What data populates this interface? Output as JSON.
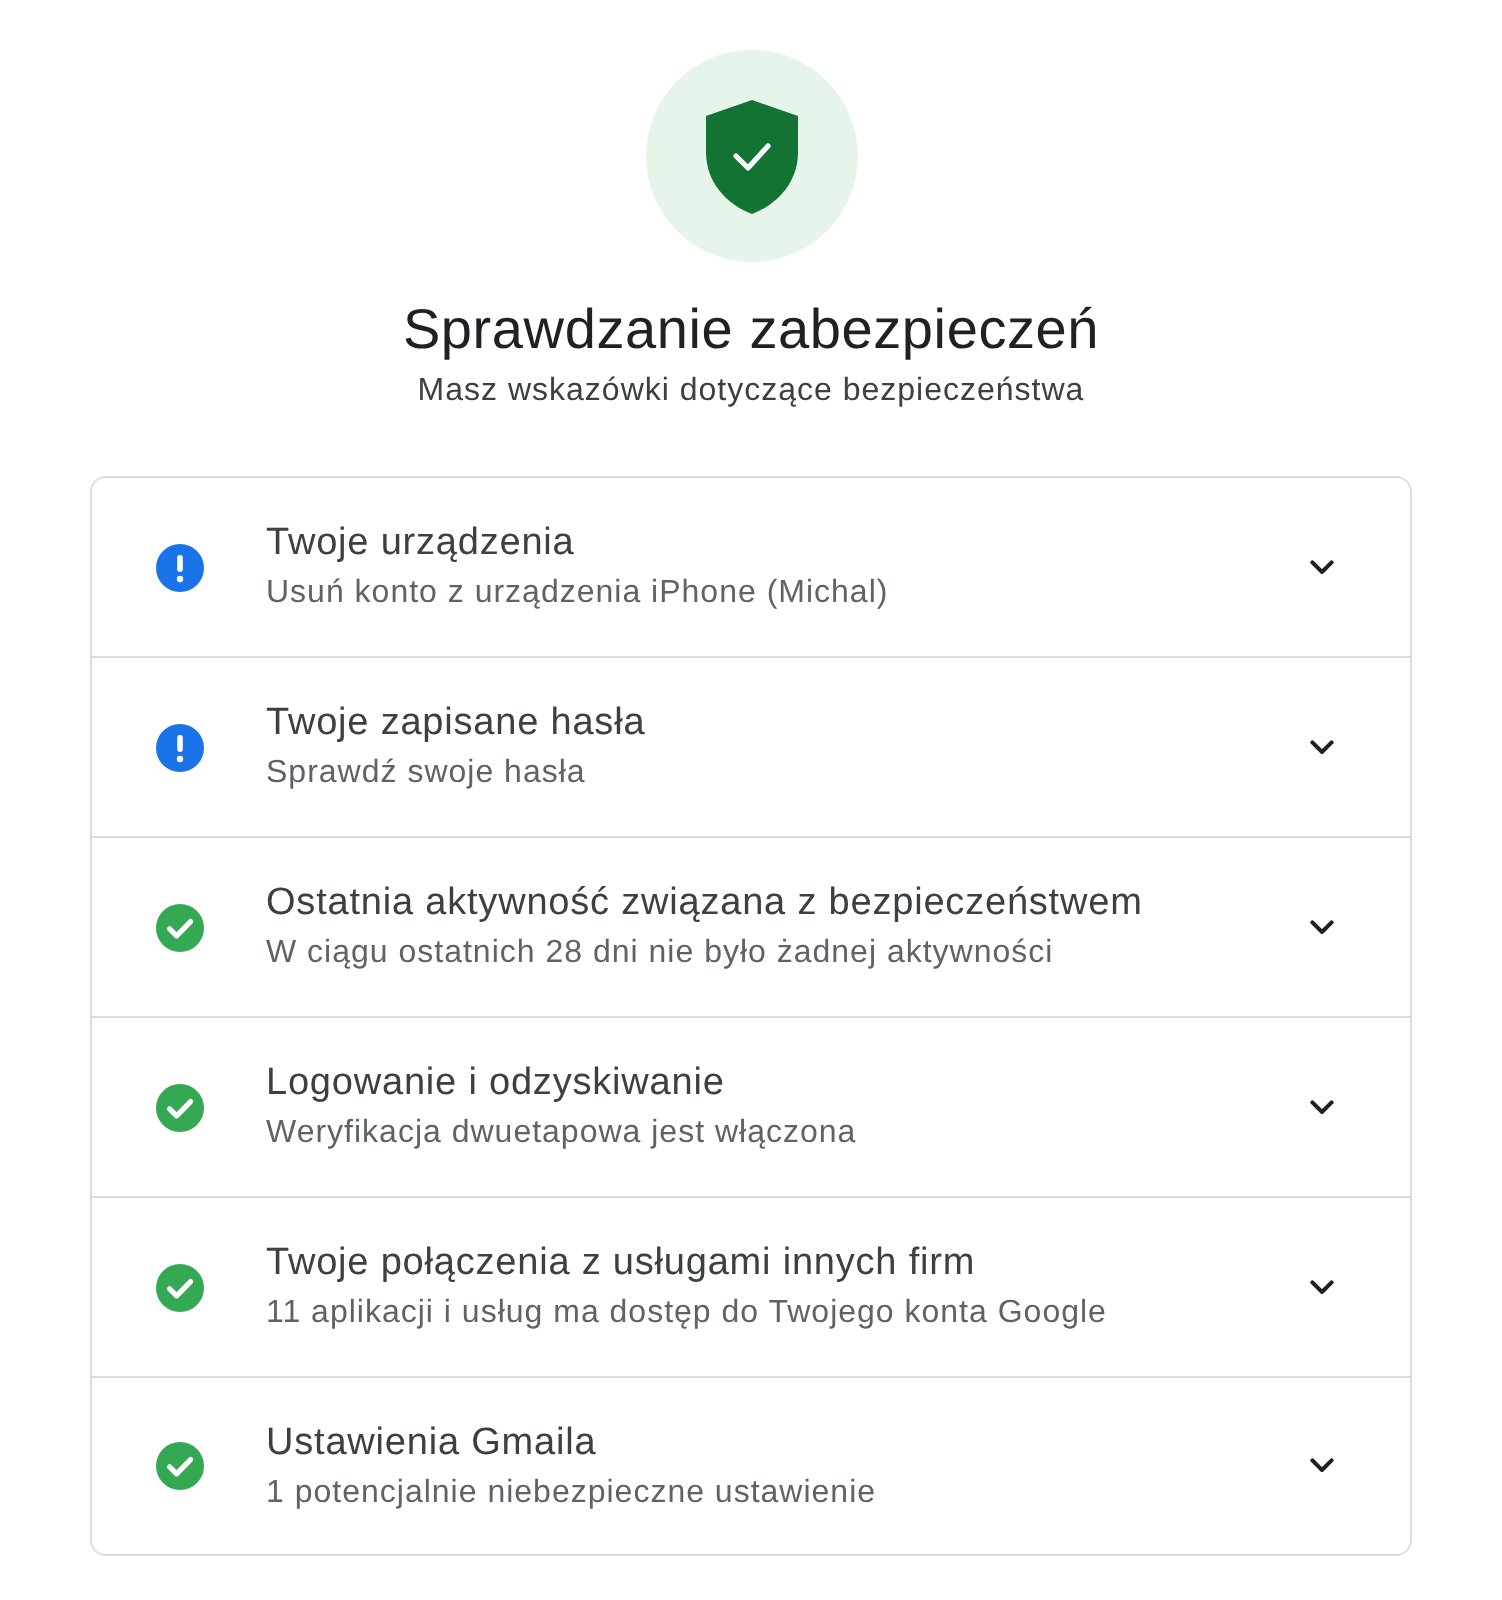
{
  "header": {
    "title": "Sprawdzanie zabezpieczeń",
    "subtitle": "Masz wskazówki dotyczące bezpieczeństwa"
  },
  "items": [
    {
      "kind": "warning",
      "title": "Twoje urządzenia",
      "subtitle": "Usuń konto z urządzenia iPhone (Michal)",
      "expanded": false
    },
    {
      "kind": "warning",
      "title": "Twoje zapisane hasła",
      "subtitle": "Sprawdź swoje hasła",
      "expanded": false
    },
    {
      "kind": "ok",
      "title": "Ostatnia aktywność związana z bezpieczeństwem",
      "subtitle": "W ciągu ostatnich 28 dni nie było żadnej aktywności",
      "expanded": false
    },
    {
      "kind": "ok",
      "title": "Logowanie i odzyskiwanie",
      "subtitle": "Weryfikacja dwuetapowa jest włączona",
      "expanded": false
    },
    {
      "kind": "ok",
      "title": "Twoje połączenia z usługami innych firm",
      "subtitle": "11 aplikacji i usług ma dostęp do Twojego konta Google",
      "expanded": false
    },
    {
      "kind": "ok",
      "title": "Ustawienia Gmaila",
      "subtitle": "1 potencjalnie niebezpieczne ustawienie",
      "expanded": false
    }
  ]
}
